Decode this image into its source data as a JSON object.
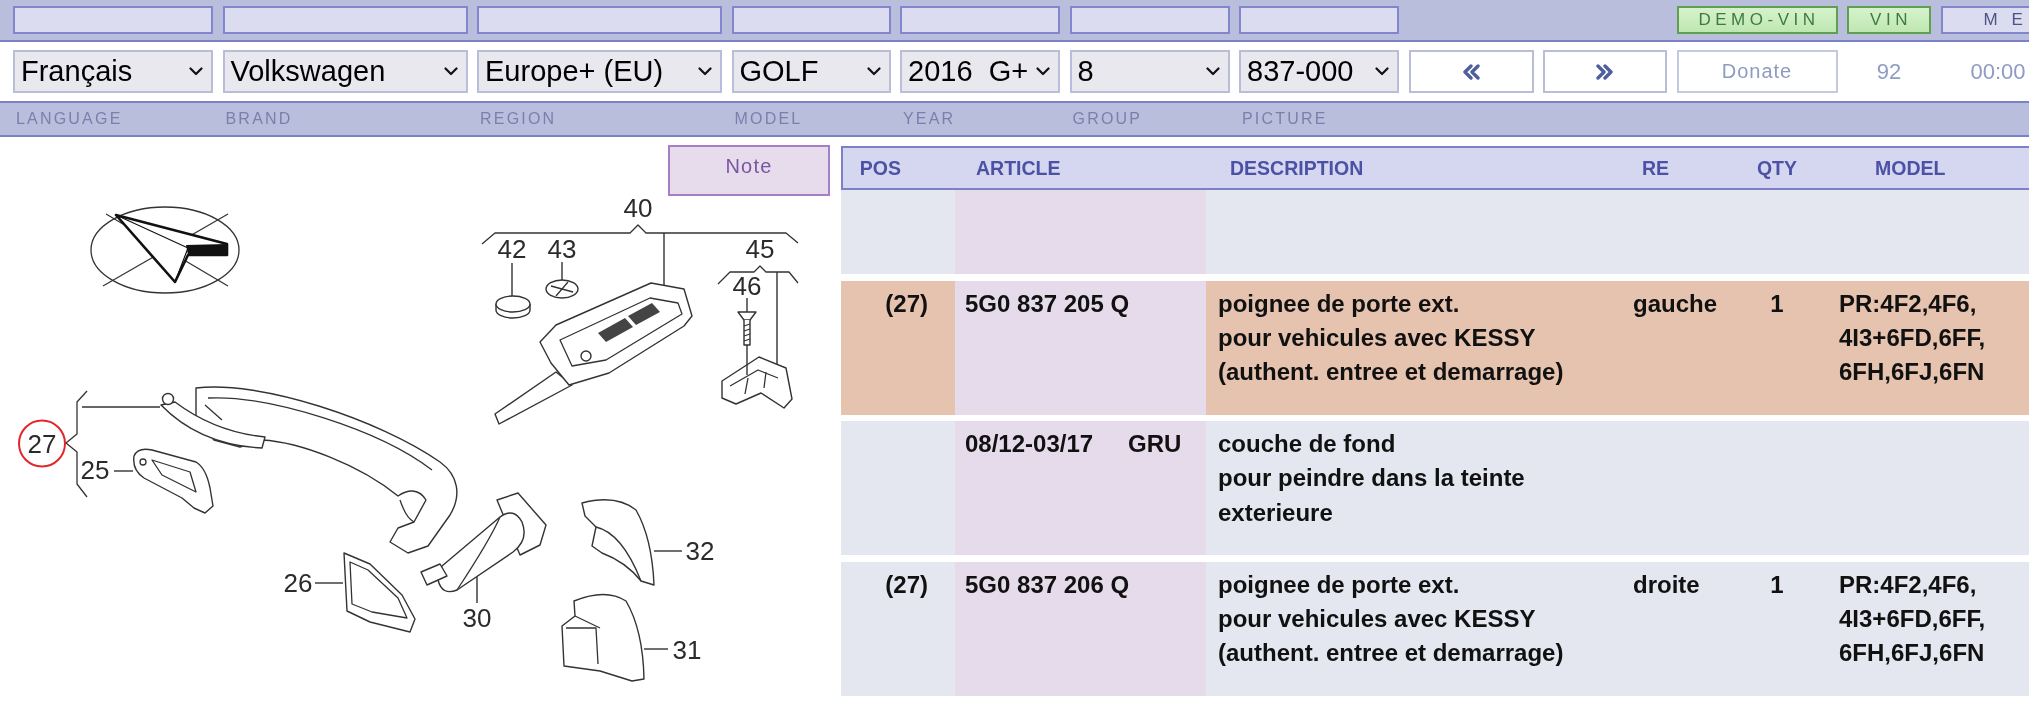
{
  "top_bar": {
    "buttons": [
      {
        "label": "DEMO-VIN",
        "kind": "vin"
      },
      {
        "label": "VIN",
        "kind": "vin"
      },
      {
        "label": "M E",
        "kind": "menu"
      }
    ]
  },
  "selectors": [
    {
      "label": "LANGUAGE",
      "value": "Français"
    },
    {
      "label": "BRAND",
      "value": "Volkswagen"
    },
    {
      "label": "REGION",
      "value": "Europe+ (EU)"
    },
    {
      "label": "MODEL",
      "value": "GOLF"
    },
    {
      "label": "YEAR",
      "value": "2016  G+"
    },
    {
      "label": "GROUP",
      "value": "8"
    },
    {
      "label": "PICTURE",
      "value": "837-000"
    }
  ],
  "navigation": {
    "donate": "Donate",
    "count": "92",
    "time": "00:00"
  },
  "diagram": {
    "note": "Note",
    "callouts": [
      {
        "label": "40",
        "selected": false
      },
      {
        "label": "42",
        "selected": false
      },
      {
        "label": "43",
        "selected": false
      },
      {
        "label": "45",
        "selected": false
      },
      {
        "label": "46",
        "selected": false
      },
      {
        "label": "27",
        "selected": true
      },
      {
        "label": "25",
        "selected": false
      },
      {
        "label": "26",
        "selected": false
      },
      {
        "label": "30",
        "selected": false
      },
      {
        "label": "32",
        "selected": false
      },
      {
        "label": "31",
        "selected": false
      }
    ]
  },
  "table": {
    "columns": [
      "POS",
      "ARTICLE",
      "DESCRIPTION",
      "RE",
      "QTY",
      "MODEL"
    ],
    "rows": [
      {
        "kind": "blank",
        "selected": false
      },
      {
        "kind": "part",
        "selected": true,
        "pos": "(27)",
        "article": "5G0 837 205 Q",
        "description": "poignee de porte ext.\npour vehicules avec KESSY\n(authent. entree et demarrage)",
        "re": "gauche",
        "qty": "1",
        "model": "PR:4F2,4F6,\n4I3+6FD,6FF,\n6FH,6FJ,6FN"
      },
      {
        "kind": "note",
        "selected": false,
        "validity": "08/12-03/17",
        "code": "GRU",
        "description": "couche de fond\npour peindre dans la teinte\nexterieure"
      },
      {
        "kind": "part",
        "selected": false,
        "pos": "(27)",
        "article": "5G0 837 206 Q",
        "description": "poignee de porte ext.\npour vehicules avec KESSY\n(authent. entree et demarrage)",
        "re": "droite",
        "qty": "1",
        "model": "PR:4F2,4F6,\n4I3+6FD,6FF,\n6FH,6FJ,6FN"
      }
    ]
  }
}
